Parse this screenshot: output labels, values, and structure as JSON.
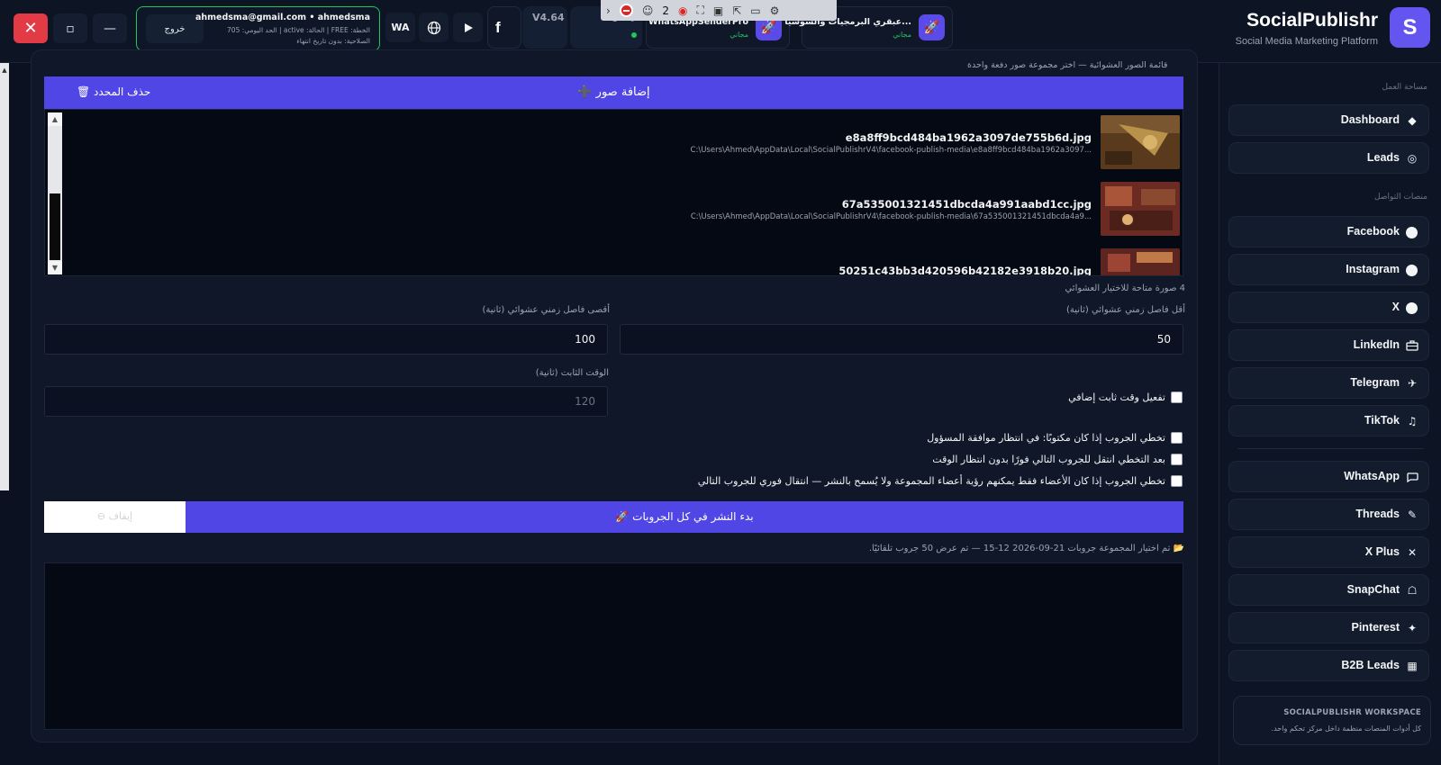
{
  "window": {
    "close_icon": "close-icon",
    "maximize_icon": "maximize-icon",
    "minimize_icon": "minimize-icon"
  },
  "user": {
    "logout_label": "خروج",
    "line1": "ahmedsma@gmail.com  •  ahmedsma",
    "line2": "الخطة: FREE  |  الحالة: active  |  الحد اليومي: 705",
    "line3": "الصلاحية: بدون تاريخ انتهاء",
    "status_color": "#22c55e"
  },
  "toolbar": {
    "wa_label": "WA",
    "fb_label": "f",
    "version": "V4.64",
    "running_label": "يعمل",
    "recorder_count": "2"
  },
  "apps": [
    {
      "title": "WhatsAppSenderPro",
      "sub": "مجاني",
      "icon": "rocket-icon"
    },
    {
      "title": "عبقري البرمجيات والسوشيا...",
      "sub": "مجاني",
      "icon": "rocket-icon"
    }
  ],
  "brand": {
    "logo_letter": "S",
    "name": "SocialPublishr",
    "subtitle": "Social Media Marketing Platform",
    "accent": "#6355f0"
  },
  "sidebar": {
    "section_workspace": "مساحة العمل",
    "section_platforms": "منصات التواصل",
    "items": [
      {
        "label": "Dashboard",
        "icon": "diamond-icon"
      },
      {
        "label": "Leads",
        "icon": "target-icon"
      },
      {
        "label": "Facebook",
        "icon": "circle-icon"
      },
      {
        "label": "Instagram",
        "icon": "circle-icon"
      },
      {
        "label": "X",
        "icon": "circle-icon"
      },
      {
        "label": "LinkedIn",
        "icon": "briefcase-icon"
      },
      {
        "label": "Telegram",
        "icon": "plane-icon"
      },
      {
        "label": "TikTok",
        "icon": "music-icon"
      },
      {
        "label": "WhatsApp",
        "icon": "chat-icon"
      },
      {
        "label": "Threads",
        "icon": "edit-icon"
      },
      {
        "label": "X Plus",
        "icon": "x-icon"
      },
      {
        "label": "SnapChat",
        "icon": "ghost-icon"
      },
      {
        "label": "Pinterest",
        "icon": "pin-icon"
      },
      {
        "label": "B2B Leads",
        "icon": "building-icon"
      }
    ],
    "footer_title": "SOCIALPUBLISHR WORKSPACE",
    "footer_text": "كل أدوات المنصات منظمة داخل مركز تحكم واحد."
  },
  "main": {
    "list_caption": "قائمة الصور العشوائية — اختر مجموعة صور دفعة واحدة",
    "add_images_label": "إضافة صور ➕",
    "delete_selected_label": "حذف المحدد 🗑",
    "images": [
      {
        "name": "e8a8ff9bcd484ba1962a3097de755b6d.jpg",
        "path": "C:\\Users\\Ahmed\\AppData\\Local\\SocialPublishrV4\\facebook-publish-media\\e8a8ff9bcd484ba1962a3097..."
      },
      {
        "name": "67a535001321451dbcda4a991aabd1cc.jpg",
        "path": "C:\\Users\\Ahmed\\AppData\\Local\\SocialPublishrV4\\facebook-publish-media\\67a535001321451dbcda4a9..."
      },
      {
        "name": "50251c43bb3d420596b42182e3918b20.jpg",
        "path": ""
      }
    ],
    "images_count_text": "4 صورة متاحة للاختيار العشوائي",
    "min_interval_label": "أقل فاصل زمني عشوائي (ثانية)",
    "max_interval_label": "أقصى فاصل زمني عشوائي (ثانية)",
    "min_interval_value": "50",
    "max_interval_value": "100",
    "fixed_time_label": "الوقت الثابت (ثانية)",
    "fixed_time_value": "120",
    "enable_fixed_label": "تفعيل وقت ثابت إضافي",
    "skip_pending_label": "تخطي الجروب إذا كان مكتوبًا: في انتظار موافقة المسؤول",
    "skip_next_label": "بعد التخطي انتقل للجروب التالي فورًا بدون انتظار الوقت",
    "skip_members_label": "تخطي الجروب إذا كان الأعضاء فقط يمكنهم رؤية أعضاء المجموعة ولا يُسمح بالنشر — انتقال فوري للجروب التالي",
    "start_label": "بدء النشر في كل الجروبات 🚀",
    "stop_label": "إيقاف ⊖",
    "status_text": "📂 تم اختيار المجموعة جروبات 21-09-2026 12-15 — تم عرض 50 جروب تلقائيًا."
  }
}
